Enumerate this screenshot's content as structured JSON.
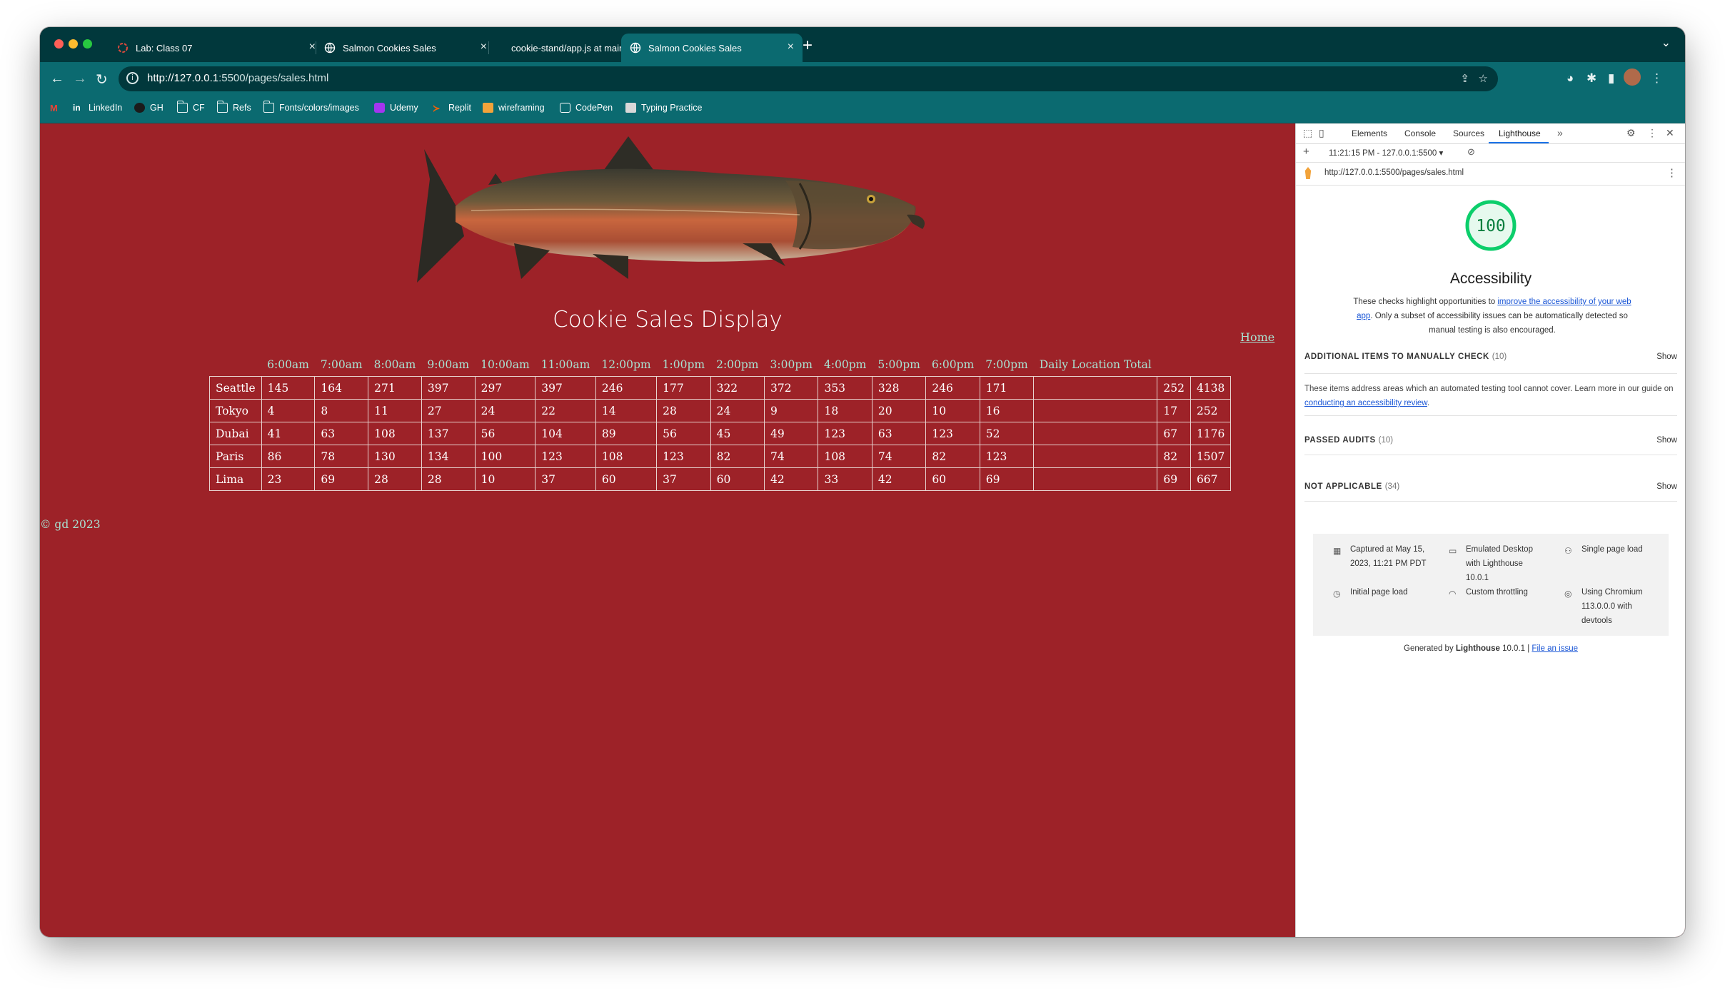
{
  "browser": {
    "tabs": [
      {
        "title": "Lab: Class 07",
        "icon": "loading-spinner-icon"
      },
      {
        "title": "Salmon Cookies Sales",
        "icon": "globe-icon"
      },
      {
        "title": "cookie-stand/app.js at main · D",
        "icon": "github-icon"
      },
      {
        "title": "Salmon Cookies Sales",
        "icon": "globe-icon",
        "active": true
      }
    ],
    "url_host": "http://127.0.0.1",
    "url_path": ":5500/pages/sales.html",
    "bookmarks": [
      {
        "label": "",
        "icon": "gmail-icon"
      },
      {
        "label": "LinkedIn",
        "icon": "linkedin-icon"
      },
      {
        "label": "GH",
        "icon": "github-icon"
      },
      {
        "label": "CF",
        "icon": "folder-icon"
      },
      {
        "label": "Refs",
        "icon": "folder-icon"
      },
      {
        "label": "Fonts/colors/images",
        "icon": "folder-icon"
      },
      {
        "label": "Udemy",
        "icon": "udemy-icon"
      },
      {
        "label": "Replit",
        "icon": "replit-icon"
      },
      {
        "label": "wireframing",
        "icon": "wireframing-icon"
      },
      {
        "label": "CodePen",
        "icon": "codepen-icon"
      },
      {
        "label": "Typing Practice",
        "icon": "typing-icon"
      }
    ]
  },
  "page": {
    "title": "Cookie Sales Display",
    "home_link": "Home",
    "footer": "© gd 2023",
    "colors": {
      "background": "#9d2228",
      "accent": "#a8e1d1"
    },
    "table": {
      "headers": [
        "",
        "6:00am",
        "7:00am",
        "8:00am",
        "9:00am",
        "10:00am",
        "11:00am",
        "12:00pm",
        "1:00pm",
        "2:00pm",
        "3:00pm",
        "4:00pm",
        "5:00pm",
        "6:00pm",
        "7:00pm",
        "Daily Location Total",
        "",
        ""
      ],
      "rows": [
        [
          "Seattle",
          "145",
          "164",
          "271",
          "397",
          "297",
          "397",
          "246",
          "177",
          "322",
          "372",
          "353",
          "328",
          "246",
          "171",
          "",
          "252",
          "4138"
        ],
        [
          "Tokyo",
          "4",
          "8",
          "11",
          "27",
          "24",
          "22",
          "14",
          "28",
          "24",
          "9",
          "18",
          "20",
          "10",
          "16",
          "",
          "17",
          "252"
        ],
        [
          "Dubai",
          "41",
          "63",
          "108",
          "137",
          "56",
          "104",
          "89",
          "56",
          "45",
          "49",
          "123",
          "63",
          "123",
          "52",
          "",
          "67",
          "1176"
        ],
        [
          "Paris",
          "86",
          "78",
          "130",
          "134",
          "100",
          "123",
          "108",
          "123",
          "82",
          "74",
          "108",
          "74",
          "82",
          "123",
          "",
          "82",
          "1507"
        ],
        [
          "Lima",
          "23",
          "69",
          "28",
          "28",
          "10",
          "37",
          "60",
          "37",
          "60",
          "42",
          "33",
          "42",
          "60",
          "69",
          "",
          "69",
          "667"
        ]
      ]
    }
  },
  "devtools": {
    "tabs": [
      "Elements",
      "Console",
      "Sources",
      "Lighthouse"
    ],
    "active_tab": "Lighthouse",
    "report_selector": "11:21:15 PM - 127.0.0.1:5500",
    "report_url": "http://127.0.0.1:5500/pages/sales.html",
    "score": "100",
    "score_color": "#0cce6b",
    "category": "Accessibility",
    "desc_before": "These checks highlight opportunities to ",
    "desc_link": "improve the accessibility of your web app",
    "desc_after": ". Only a subset of accessibility issues can be automatically detected so manual testing is also encouraged.",
    "sections": [
      {
        "title": "ADDITIONAL ITEMS TO MANUALLY CHECK",
        "count": "(10)",
        "action": "Show"
      },
      {
        "title": "PASSED AUDITS",
        "count": "(10)",
        "action": "Show"
      },
      {
        "title": "NOT APPLICABLE",
        "count": "(34)",
        "action": "Show"
      }
    ],
    "manual_desc_before": "These items address areas which an automated testing tool cannot cover. Learn more in our guide on ",
    "manual_desc_link": "conducting an accessibility review",
    "manual_desc_after": ".",
    "env": [
      {
        "text": "Captured at May 15, 2023, 11:21 PM PDT",
        "icon": "calendar-icon"
      },
      {
        "text": "Emulated Desktop with Lighthouse 10.0.1",
        "icon": "devices-icon"
      },
      {
        "text": "Single page load",
        "icon": "person-icon"
      },
      {
        "text": "Initial page load",
        "icon": "timer-icon"
      },
      {
        "text": "Custom throttling",
        "icon": "wifi-icon"
      },
      {
        "text": "Using Chromium 113.0.0.0 with devtools",
        "icon": "chromium-icon"
      }
    ],
    "generated_before": "Generated by ",
    "generated_bold": "Lighthouse",
    "generated_version": " 10.0.1 | ",
    "generated_link": "File an issue"
  }
}
